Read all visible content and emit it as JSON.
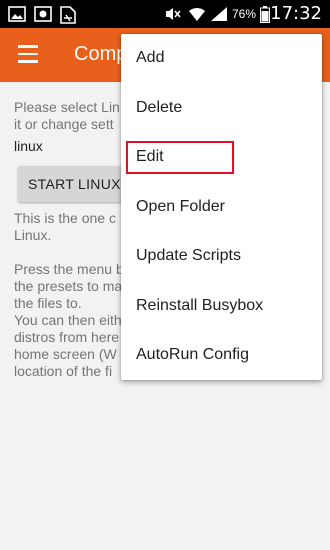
{
  "status": {
    "battery": "76%",
    "time": "17:32",
    "icons": [
      "image-icon",
      "photo-icon",
      "sim-icon",
      "mute-icon",
      "wifi-icon",
      "signal-icon",
      "battery-icon"
    ]
  },
  "appbar": {
    "title": "Comp",
    "menu_icon": "hamburger-menu-icon"
  },
  "content": {
    "intro_lines": [
      "Please select Lin",
      "it or change sett"
    ],
    "linux_name": "linux",
    "start_button": "START LINUX",
    "desc1_lines": [
      "This is the one c",
      "Linux."
    ],
    "desc2_lines": [
      "Press the menu b",
      "the presets to ma",
      "the files to.",
      "You can then eith",
      "distros from here",
      "home screen (W",
      "location of the fi"
    ]
  },
  "menu": {
    "items": [
      {
        "label": "Add"
      },
      {
        "label": "Delete"
      },
      {
        "label": "Edit"
      },
      {
        "label": "Open Folder"
      },
      {
        "label": "Update Scripts"
      },
      {
        "label": "Reinstall Busybox"
      },
      {
        "label": "AutoRun Config"
      }
    ]
  },
  "colors": {
    "appbar": "#e8601c",
    "highlight": "#e0102a"
  }
}
